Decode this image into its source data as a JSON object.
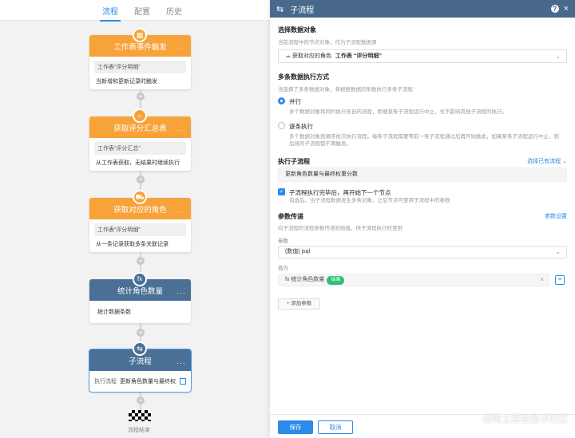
{
  "canvas": {
    "tabs": [
      "流程",
      "配置",
      "历史"
    ],
    "active_tab": "流程",
    "nodes": [
      {
        "title": "工作表事件触发",
        "icon": "table-icon",
        "chip": "工作表“评分明细”",
        "line": "当新增和更新记录时触发"
      },
      {
        "title": "获取评分汇总表",
        "icon": "search-icon",
        "chip": "工作表“评分汇总”",
        "line": "从工作表获取，无结果时继续执行"
      },
      {
        "title": "获取对应的角色",
        "icon": "truck-icon",
        "chip": "工作表“评分明细”",
        "line": "从一条记录获取多条关联记录"
      },
      {
        "title": "统计角色数量",
        "icon": "fx-icon",
        "chip": "",
        "line": "统计数据条数"
      },
      {
        "title": "子流程",
        "icon": "subflow-icon",
        "label": "执行流程",
        "value": "更新角色数量与最终权..."
      }
    ],
    "end_label": "流程结束",
    "more": "···",
    "plus": "+"
  },
  "panel": {
    "title": "子流程",
    "help_label": "?",
    "close_label": "×",
    "data_object": {
      "title": "选择数据对象",
      "desc": "当前流程中的节点对象，作为子流程数据源",
      "select_prefix": "获取对应的角色",
      "select_value": "工作表 “评分明细”"
    },
    "exec_mode": {
      "title": "多条数据执行方式",
      "desc": "当选择了多条数据对象，将根据数据的条数执行多条子流程",
      "options": [
        {
          "label": "并行",
          "desc": "多个数据对象将同时执行各自的流程，即便某条子流程运行中止，也不影响其他子流程的执行。",
          "selected": true
        },
        {
          "label": "逐条执行",
          "desc": "多个数据对象按顺序依次执行流程。每条子流程需要等前一条子流程通过后再开始触发，如果某条子流程运行中止，则后续的子流程都不再触发。",
          "selected": false
        }
      ]
    },
    "sub_process": {
      "title": "执行子流程",
      "link": "选择已有流程",
      "value": "更新角色数量与最终权重分数",
      "check_label": "子流程执行完毕后，再开始下一个节点",
      "check_desc": "勾选后，当子流程数据发生多条对象，之后节点可使用子流程中的参数"
    },
    "params": {
      "title": "参数传递",
      "link": "参数设置",
      "desc": "向子流程的流程参数传递初始值，供子流程执行时使用",
      "param_label": "参数",
      "param_value": "(数值) jsql",
      "assign_label": "值为",
      "assign_prefix": "fx 统计角色数量",
      "assign_token": "结果",
      "add_label": "+ 添加参数"
    },
    "footer": {
      "save": "保存",
      "cancel": "取消"
    }
  },
  "watermark": "@稀土掘金技术社区"
}
